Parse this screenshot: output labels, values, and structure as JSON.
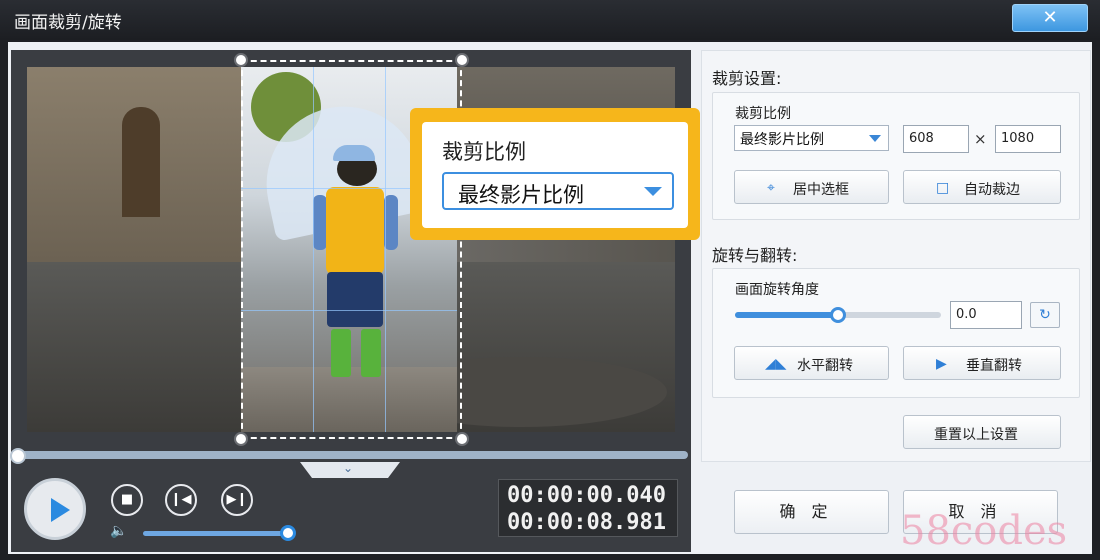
{
  "window": {
    "title": "画面裁剪/旋转",
    "close_symbol": "✕"
  },
  "crop_settings": {
    "section_title": "裁剪设置:",
    "ratio_label": "裁剪比例",
    "ratio_selected": "最终影片比例",
    "width_value": "608",
    "times_symbol": "×",
    "height_value": "1080",
    "center_button": "居中选框",
    "auto_crop_button": "自动裁边"
  },
  "callout": {
    "label": "裁剪比例",
    "selected": "最终影片比例"
  },
  "rotate_flip": {
    "section_title": "旋转与翻转:",
    "angle_label": "画面旋转角度",
    "angle_value": "0.0",
    "angle_fraction": 0.5,
    "flip_horizontal_button": "水平翻转",
    "flip_vertical_button": "垂直翻转",
    "reset_button": "重置以上设置"
  },
  "playback": {
    "current_time": "00:00:00.040",
    "total_time": "00:00:08.981",
    "volume_fraction": 0.95,
    "progress_fraction": 0.0
  },
  "dialog_buttons": {
    "ok": "确定",
    "cancel": "取消"
  },
  "watermark": "58codes",
  "colors": {
    "accent_blue": "#3f8fdd",
    "callout_yellow": "#f6b61b",
    "titlebar": "#1c1e22"
  },
  "icons": [
    "close-icon",
    "play-icon",
    "stop-icon",
    "prev-frame-icon",
    "next-frame-icon",
    "volume-icon",
    "center-box-icon",
    "auto-crop-icon",
    "rotate-icon",
    "flip-horizontal-icon",
    "flip-vertical-icon",
    "chevron-down-icon"
  ]
}
